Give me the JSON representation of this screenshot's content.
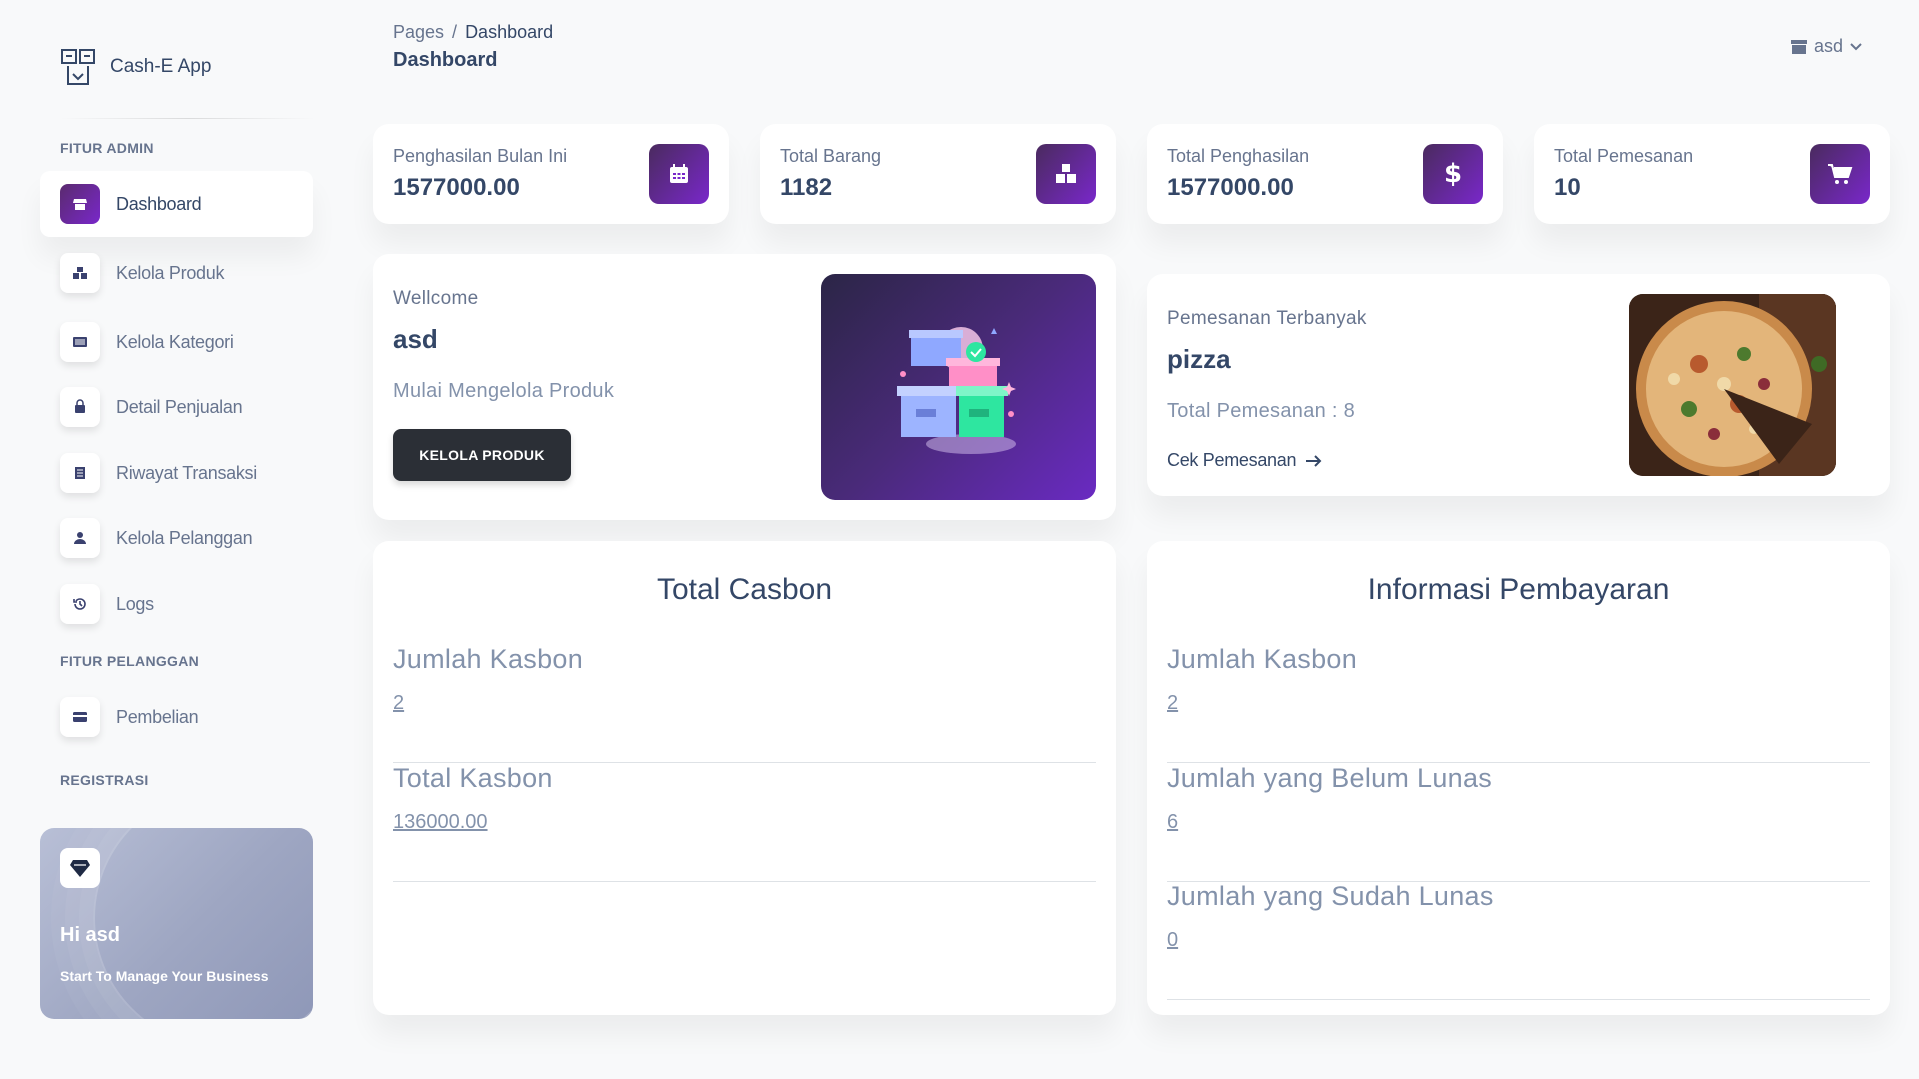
{
  "brand": {
    "name": "Cash-E App",
    "icon": "cash-register-icon"
  },
  "sidebar": {
    "sections": {
      "admin": "FITUR ADMIN",
      "customer": "FITUR PELANGGAN",
      "register": "REGISTRASI"
    },
    "items": [
      {
        "label": "Dashboard",
        "icon": "shop-icon",
        "active": true
      },
      {
        "label": "Kelola Produk",
        "icon": "boxes-icon"
      },
      {
        "label": "Kelola Kategori",
        "icon": "list-icon"
      },
      {
        "label": "Detail Penjualan",
        "icon": "shopping-bag-icon"
      },
      {
        "label": "Riwayat Transaksi",
        "icon": "receipt-icon"
      },
      {
        "label": "Kelola Pelanggan",
        "icon": "user-icon"
      },
      {
        "label": "Logs",
        "icon": "history-icon"
      },
      {
        "label": "Pembelian",
        "icon": "credit-card-icon"
      }
    ],
    "promo": {
      "title": "Hi asd",
      "subtitle": "Start To Manage Your Business",
      "icon": "diamond-icon"
    }
  },
  "header": {
    "breadcrumb_root": "Pages",
    "breadcrumb_sep": "/",
    "breadcrumb_current": "Dashboard",
    "title": "Dashboard",
    "user": "asd"
  },
  "stats": [
    {
      "label": "Penghasilan Bulan Ini",
      "value": "1577000.00",
      "icon": "calendar-icon"
    },
    {
      "label": "Total Barang",
      "value": "1182",
      "icon": "boxes-icon"
    },
    {
      "label": "Total Penghasilan",
      "value": "1577000.00",
      "icon": "dollar-icon"
    },
    {
      "label": "Total Pemesanan",
      "value": "10",
      "icon": "cart-icon"
    }
  ],
  "welcome": {
    "greeting": "Wellcome",
    "name": "asd",
    "description": "Mulai Mengelola Produk",
    "button": "KELOLA PRODUK"
  },
  "favorite": {
    "title": "Pemesanan Terbanyak",
    "product": "pizza",
    "count_text": "Total Pemesanan : 8",
    "link": "Cek Pemesanan"
  },
  "casbon": {
    "title": "Total Casbon",
    "rows": [
      {
        "label": "Jumlah Kasbon",
        "value": "2"
      },
      {
        "label": "Total Kasbon",
        "value": "136000.00"
      }
    ]
  },
  "payment": {
    "title": "Informasi Pembayaran",
    "rows": [
      {
        "label": "Jumlah Kasbon",
        "value": "2"
      },
      {
        "label": "Jumlah yang Belum Lunas",
        "value": "6"
      },
      {
        "label": "Jumlah yang Sudah Lunas",
        "value": "0"
      }
    ]
  },
  "colors": {
    "accent": "#7928ca",
    "text": "#344767",
    "muted": "#67748e",
    "background": "#f8f9fa"
  }
}
